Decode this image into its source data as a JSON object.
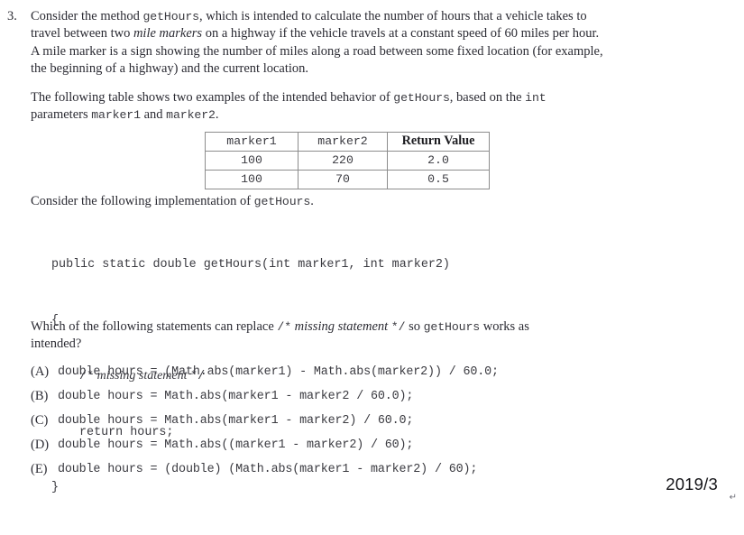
{
  "question": {
    "number": "3.",
    "intro_lines": [
      {
        "segments": [
          {
            "t": "Consider the method ",
            "s": "serif"
          },
          {
            "t": "getHours",
            "s": "mono"
          },
          {
            "t": ",  which is intended to calculate the number of hours that a vehicle takes to",
            "s": "serif"
          }
        ]
      },
      {
        "segments": [
          {
            "t": "travel between two ",
            "s": "serif"
          },
          {
            "t": "mile markers",
            "s": "italic"
          },
          {
            "t": " on a highway if the vehicle travels at a constant speed of 60 miles per hour.",
            "s": "serif"
          }
        ]
      },
      {
        "segments": [
          {
            "t": "A mile marker is a sign showing the number of miles along a road between some fixed location (for example,",
            "s": "serif"
          }
        ]
      },
      {
        "segments": [
          {
            "t": "the beginning of a highway) and the current location.",
            "s": "serif"
          }
        ]
      }
    ],
    "table_intro_lines": [
      {
        "segments": [
          {
            "t": "The following table shows two examples of the intended behavior of ",
            "s": "serif"
          },
          {
            "t": "getHours",
            "s": "mono"
          },
          {
            "t": ",  based on the ",
            "s": "serif"
          },
          {
            "t": "int",
            "s": "mono"
          }
        ]
      },
      {
        "segments": [
          {
            "t": "parameters ",
            "s": "serif"
          },
          {
            "t": "marker1",
            "s": "mono"
          },
          {
            "t": " and ",
            "s": "serif"
          },
          {
            "t": "marker2",
            "s": "mono"
          },
          {
            "t": ".",
            "s": "serif"
          }
        ]
      }
    ],
    "implementation_intro": {
      "segments": [
        {
          "t": "Consider the following implementation of ",
          "s": "serif"
        },
        {
          "t": "getHours",
          "s": "mono"
        },
        {
          "t": ".",
          "s": "serif"
        }
      ]
    },
    "stem_lines": [
      {
        "segments": [
          {
            "t": "Which of the following statements can replace ",
            "s": "serif"
          },
          {
            "t": "/*",
            "s": "mono"
          },
          {
            "t": " missing statement ",
            "s": "italic"
          },
          {
            "t": "*/",
            "s": "mono"
          },
          {
            "t": " so ",
            "s": "serif"
          },
          {
            "t": "getHours",
            "s": "mono"
          },
          {
            "t": " works as",
            "s": "serif"
          }
        ]
      },
      {
        "segments": [
          {
            "t": "intended?",
            "s": "serif"
          }
        ]
      }
    ]
  },
  "table": {
    "headers": [
      "marker1",
      "marker2",
      "Return Value"
    ],
    "rows": [
      [
        "100",
        "220",
        "2.0"
      ],
      [
        "100",
        "70",
        "0.5"
      ]
    ]
  },
  "code": {
    "line1": "public static double getHours(int marker1, int marker2)",
    "line2": "{",
    "comment_open": "/*",
    "comment_text": " missing statement ",
    "comment_close": "*/",
    "line4": "return hours;",
    "line5": "}"
  },
  "choices": [
    {
      "label": "(A)",
      "code": "double hours = (Math.abs(marker1) - Math.abs(marker2)) / 60.0;"
    },
    {
      "label": "(B)",
      "code": "double hours = Math.abs(marker1 - marker2 / 60.0);"
    },
    {
      "label": "(C)",
      "code": "double hours = Math.abs(marker1 - marker2) / 60.0;"
    },
    {
      "label": "(D)",
      "code": "double hours = Math.abs((marker1 - marker2) / 60);"
    },
    {
      "label": "(E)",
      "code": "double hours = (double) (Math.abs(marker1 - marker2) / 60);"
    }
  ],
  "footer": {
    "date": "2019/3",
    "paragraph_mark": "↵"
  }
}
